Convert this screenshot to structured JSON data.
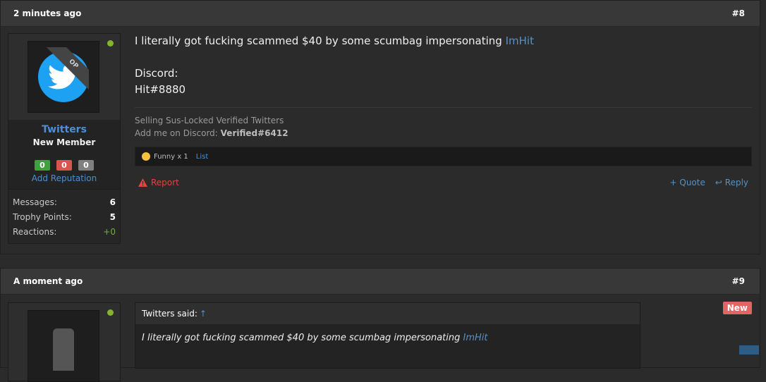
{
  "post8": {
    "time": "2 minutes ago",
    "number": "#8",
    "user": {
      "ribbon": "OP",
      "name": "Twitters",
      "title": "New Member",
      "rep": [
        "0",
        "0",
        "0"
      ],
      "add_rep": "Add Reputation",
      "stats": [
        {
          "label": "Messages:",
          "value": "6"
        },
        {
          "label": "Trophy Points:",
          "value": "5"
        },
        {
          "label": "Reactions:",
          "value": "+0"
        }
      ]
    },
    "message": {
      "line1": "I literally got fucking scammed $40 by some scumbag impersonating",
      "mention": "ImHit",
      "line2": "Discord:",
      "line3": "Hit#8880"
    },
    "signature": {
      "line1": "Selling Sus-Locked Verified Twitters",
      "line2_prefix": "Add me on Discord:",
      "line2_bold": "Verified#6412"
    },
    "reactions": {
      "text": "Funny x 1",
      "list": "List"
    },
    "actions": {
      "report": "Report",
      "quote": "+ Quote",
      "reply": "Reply"
    }
  },
  "post9": {
    "time": "A moment ago",
    "number": "#9",
    "badge": "New",
    "quote": {
      "author": "Twitters said:",
      "arrow": "↑",
      "text": "I literally got fucking scammed $40 by some scumbag impersonating",
      "mention": "ImHit"
    }
  },
  "colors": {
    "accent": "#4c8fd4",
    "online": "#84b32c",
    "report": "#e0443e"
  }
}
